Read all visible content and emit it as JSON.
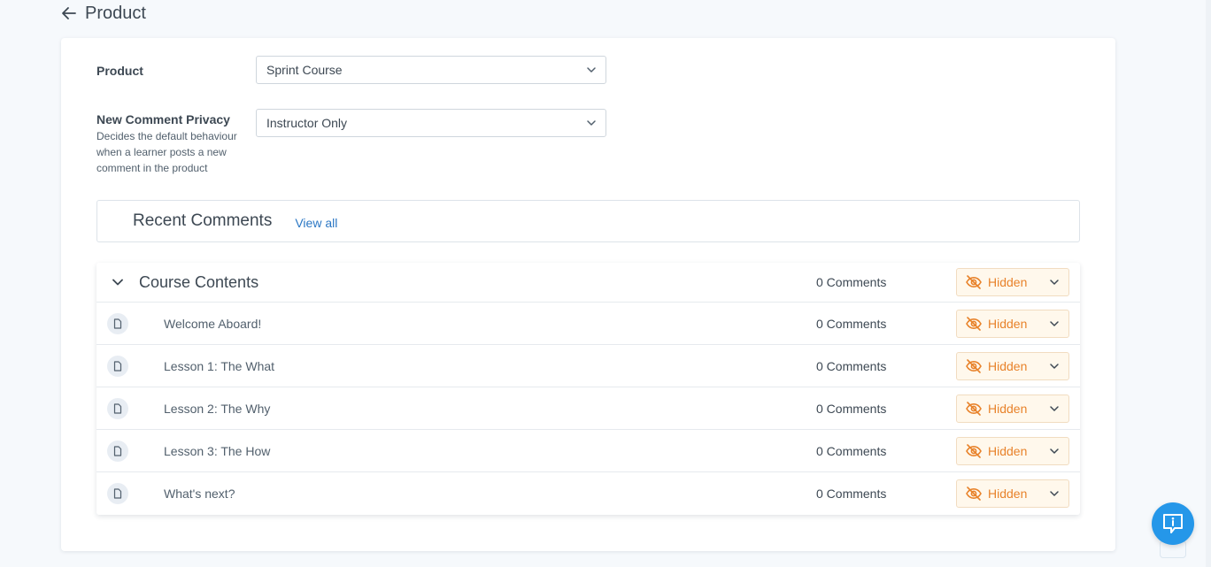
{
  "header": {
    "title": "Product",
    "back_icon": "arrow-left-icon"
  },
  "form": {
    "product": {
      "label": "Product",
      "value": "Sprint Course"
    },
    "privacy": {
      "label": "New Comment Privacy",
      "help": "Decides the default behaviour when a learner posts a new comment in the product",
      "value": "Instructor Only"
    }
  },
  "recent": {
    "title": "Recent Comments",
    "link": "View all"
  },
  "contents": {
    "section": {
      "title": "Course Contents",
      "comments": "0 Comments",
      "visibility": "Hidden"
    },
    "lessons": [
      {
        "title": "Welcome Aboard!",
        "comments": "0 Comments",
        "visibility": "Hidden"
      },
      {
        "title": "Lesson 1: The What",
        "comments": "0 Comments",
        "visibility": "Hidden"
      },
      {
        "title": "Lesson 2: The Why",
        "comments": "0 Comments",
        "visibility": "Hidden"
      },
      {
        "title": "Lesson 3: The How",
        "comments": "0 Comments",
        "visibility": "Hidden"
      },
      {
        "title": "What's next?",
        "comments": "0 Comments",
        "visibility": "Hidden"
      }
    ]
  },
  "colors": {
    "accent": "#e8822a",
    "link": "#2b77c4",
    "help_bubble": "#2597e9"
  },
  "icons": {
    "collapse": "chevron-down-icon",
    "lesson": "document-icon",
    "visibility": "eye-off-icon",
    "help": "chat-info-icon"
  }
}
